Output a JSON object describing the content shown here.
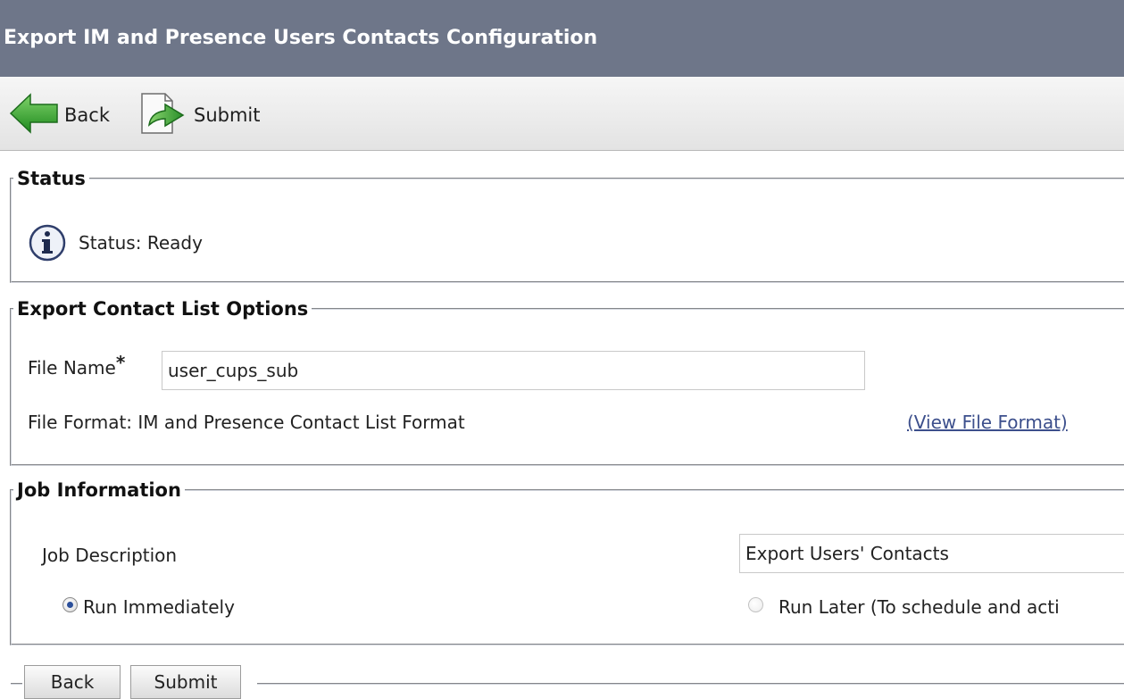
{
  "window": {
    "title": "Export IM and Presence Users Contacts Configuration"
  },
  "toolbar": {
    "back_label": "Back",
    "submit_label": "Submit"
  },
  "status": {
    "legend": "Status",
    "text": "Status: Ready",
    "icon": "info-icon"
  },
  "export_options": {
    "legend": "Export Contact List Options",
    "file_name_label": "File Name",
    "required_marker": "*",
    "file_name_value": "user_cups_sub",
    "file_format_text": "File Format: IM and Presence Contact List Format",
    "view_format_link": "(View File Format)"
  },
  "job_info": {
    "legend": "Job Information",
    "description_label": "Job Description",
    "description_value": "Export Users' Contacts",
    "run_immediately_label": "Run Immediately",
    "run_later_label": "Run Later (To schedule and acti",
    "run_immediately_selected": true
  },
  "bottom": {
    "back_label": "Back",
    "submit_label": "Submit"
  },
  "colors": {
    "title_bar": "#6e7689",
    "link": "#3c4f8c"
  }
}
